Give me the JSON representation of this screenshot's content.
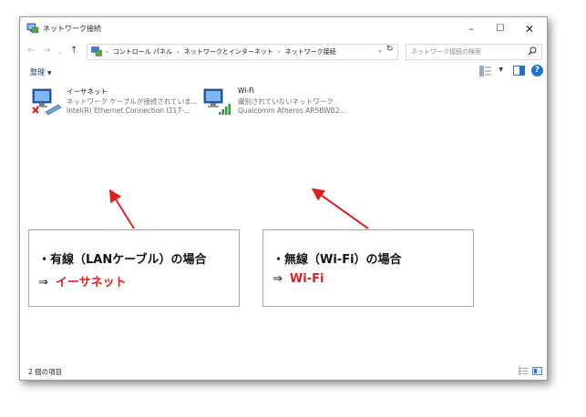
{
  "window": {
    "title": "ネットワーク接続",
    "controls": {
      "minimize": "–",
      "maximize": "☐",
      "close": "✕"
    }
  },
  "nav": {
    "back": "←",
    "forward": "→",
    "recent": "⌄",
    "up": "↑",
    "breadcrumbs": [
      "コントロール パネル",
      "ネットワークとインターネット",
      "ネットワーク接続"
    ],
    "breadcrumb_separator": "›",
    "address_dropdown": "⌄",
    "refresh": "↻",
    "search_placeholder": "ネットワーク接続の検索"
  },
  "toolbar": {
    "organize_label": "整理",
    "organize_caret": "▼",
    "view_caret": "▼",
    "help_label": "?"
  },
  "connections": [
    {
      "name": "イーサネット",
      "status": "ネットワーク ケーブルが接続されていま...",
      "device": "Intel(R) Ethernet Connection I217-...",
      "icon": "ethernet-disconnected-icon"
    },
    {
      "name": "Wi-Fi",
      "status": "識別されていないネットワーク",
      "device": "Qualcomm Atheros AR5BWB2...",
      "icon": "wifi-signal-icon"
    }
  ],
  "callouts": [
    {
      "heading": "・有線（LANケーブル）の場合",
      "arrow": "⇒",
      "value": "イーサネット"
    },
    {
      "heading": "・無線（Wi-Fi）の場合",
      "arrow": "⇒",
      "value": "Wi-Fi"
    }
  ],
  "statusbar": {
    "item_count": "2 個の項目"
  },
  "colors": {
    "annotation_red": "#e02020",
    "link_blue": "#1c3a70",
    "help_blue": "#1e73d6",
    "window_border": "#9a9a9a"
  }
}
